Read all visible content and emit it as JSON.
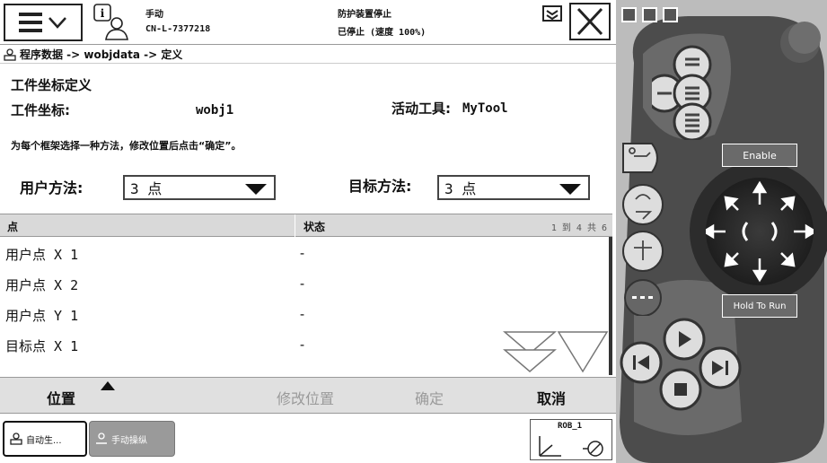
{
  "header": {
    "mode": "手动",
    "controller": "CN-L-7377218",
    "safety": "防护装置停止",
    "run_state": "已停止 (速度 100%)"
  },
  "breadcrumb": "程序数据 -> wobjdata -> 定义",
  "form": {
    "title": "工件坐标定义",
    "wobj_label": "工件坐标:",
    "wobj_value": "wobj1",
    "tool_label": "活动工具:",
    "tool_value": "MyTool",
    "instruction": "为每个框架选择一种方法，修改位置后点击“确定”。",
    "user_method_label": "用户方法:",
    "user_method_value": "3 点",
    "target_method_label": "目标方法:",
    "target_method_value": "3 点"
  },
  "table": {
    "col_point": "点",
    "col_status": "状态",
    "counter": "1 到 4 共 6",
    "rows": [
      {
        "point": "用户点 X 1",
        "status": "-"
      },
      {
        "point": "用户点 X 2",
        "status": "-"
      },
      {
        "point": "用户点 Y 1",
        "status": "-"
      },
      {
        "point": "目标点 X 1",
        "status": "-"
      }
    ]
  },
  "actions": {
    "position": "位置",
    "modify_position": "修改位置",
    "confirm": "确定",
    "cancel": "取消"
  },
  "taskbar": {
    "task1": "自动生...",
    "task2": "手动操纵",
    "rob_label": "ROB_1"
  },
  "hardware": {
    "enable": "Enable",
    "hold_to_run": "Hold To Run"
  },
  "colors": {
    "action_bar": "#e0e0e0",
    "table_header": "#d9d9d9",
    "panel_body": "#4a4a4a"
  }
}
